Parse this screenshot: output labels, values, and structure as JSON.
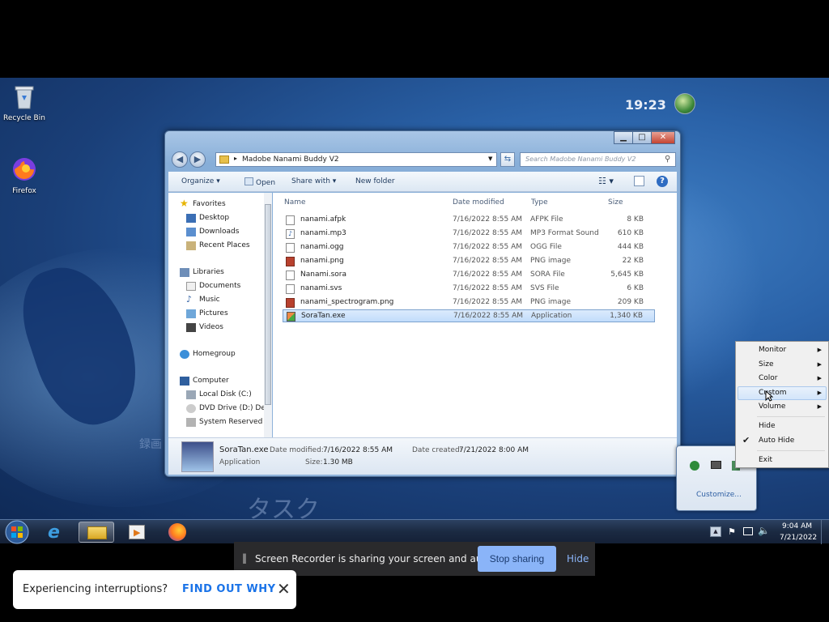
{
  "desktop": {
    "icons": [
      {
        "label": "Recycle Bin"
      },
      {
        "label": "Firefox"
      }
    ],
    "clock": "19:23",
    "wallpaper_text": [
      "録画",
      "タスク"
    ]
  },
  "explorer": {
    "address": "Madobe Nanami Buddy V2",
    "search_placeholder": "Search Madobe Nanami Buddy V2",
    "toolbar": {
      "organize": "Organize",
      "open": "Open",
      "share_with": "Share with",
      "new_folder": "New folder"
    },
    "nav": {
      "favorites": "Favorites",
      "desktop": "Desktop",
      "downloads": "Downloads",
      "recent_places": "Recent Places",
      "libraries": "Libraries",
      "documents": "Documents",
      "music": "Music",
      "pictures": "Pictures",
      "videos": "Videos",
      "homegroup": "Homegroup",
      "computer": "Computer",
      "local_disk": "Local Disk (C:)",
      "dvd_drive": "DVD Drive (D:) De",
      "system_reserved": "System Reserved"
    },
    "columns": {
      "name": "Name",
      "date_modified": "Date modified",
      "type": "Type",
      "size": "Size"
    },
    "files": [
      {
        "name": "nanami.afpk",
        "date": "7/16/2022 8:55 AM",
        "type": "AFPK File",
        "size": "8 KB"
      },
      {
        "name": "nanami.mp3",
        "date": "7/16/2022 8:55 AM",
        "type": "MP3 Format Sound",
        "size": "610 KB"
      },
      {
        "name": "nanami.ogg",
        "date": "7/16/2022 8:55 AM",
        "type": "OGG File",
        "size": "444 KB"
      },
      {
        "name": "nanami.png",
        "date": "7/16/2022 8:55 AM",
        "type": "PNG image",
        "size": "22 KB"
      },
      {
        "name": "Nanami.sora",
        "date": "7/16/2022 8:55 AM",
        "type": "SORA File",
        "size": "5,645 KB"
      },
      {
        "name": "nanami.svs",
        "date": "7/16/2022 8:55 AM",
        "type": "SVS File",
        "size": "6 KB"
      },
      {
        "name": "nanami_spectrogram.png",
        "date": "7/16/2022 8:55 AM",
        "type": "PNG image",
        "size": "209 KB"
      },
      {
        "name": "SoraTan.exe",
        "date": "7/16/2022 8:55 AM",
        "type": "Application",
        "size": "1,340 KB"
      }
    ],
    "details": {
      "name": "SoraTan.exe",
      "type": "Application",
      "date_modified_label": "Date modified:",
      "date_modified": "7/16/2022 8:55 AM",
      "date_created_label": "Date created:",
      "date_created": "7/21/2022 8:00 AM",
      "size_label": "Size:",
      "size": "1.30 MB"
    }
  },
  "context_menu": {
    "items": [
      "Monitor",
      "Size",
      "Color",
      "Custom",
      "Volume",
      "Hide",
      "Auto Hide",
      "Exit"
    ]
  },
  "tray_popup": {
    "customize": "Customize..."
  },
  "taskbar": {
    "time": "9:04 AM",
    "date": "7/21/2022"
  },
  "share_bar": {
    "text": "Screen Recorder is sharing your screen and audio.",
    "stop": "Stop sharing",
    "hide": "Hide"
  },
  "interrupt": {
    "question": "Experiencing interruptions?",
    "link": "FIND OUT WHY"
  }
}
